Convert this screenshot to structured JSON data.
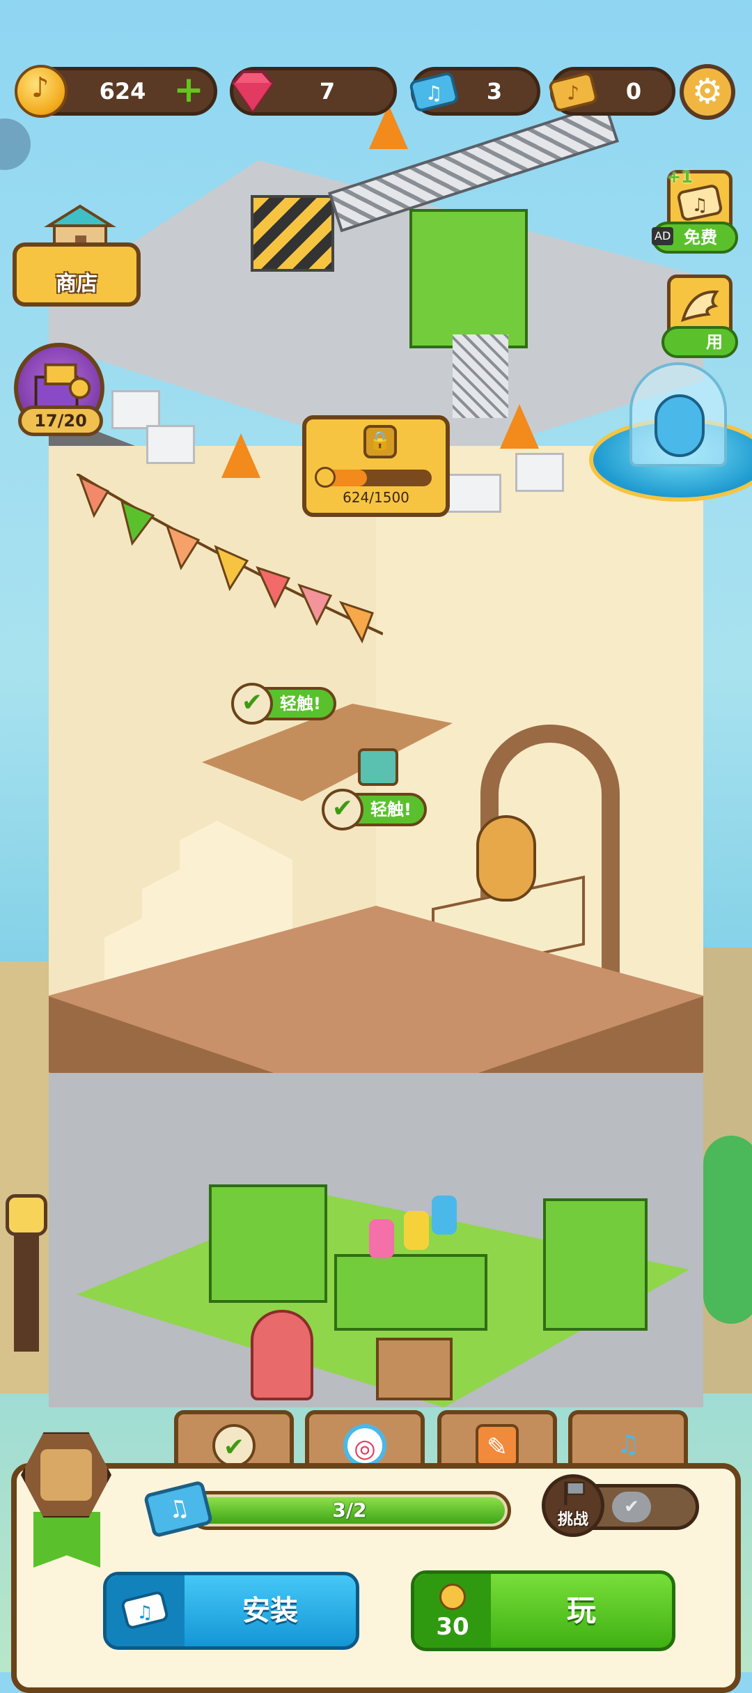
{
  "resources": {
    "coins": "624",
    "gems": "7",
    "tickets": "3",
    "golden_tickets": "0"
  },
  "side": {
    "shop_label": "商店",
    "chest_count": "17/20",
    "free_bonus": "+1",
    "free_label": "免费",
    "ad_tag": "AD",
    "use_label": "用"
  },
  "lock": {
    "progress_text": "624/1500",
    "progress_fraction": 0.416
  },
  "tap_prompts": [
    "轻触!",
    "轻触!"
  ],
  "bottom": {
    "ticket_progress": "3/2",
    "ticket_progress_fraction": 1.0,
    "challenge_label": "挑战",
    "install_label": "安装",
    "play_label": "玩",
    "play_cost": "30"
  },
  "colors": {
    "accent_green": "#5ac12c",
    "accent_blue": "#1496d6",
    "frame_brown": "#6b4319",
    "gold": "#f6c441"
  },
  "icons": {
    "coin": "music-note-coin-icon",
    "gem": "gem-icon",
    "ticket": "music-ticket-icon",
    "golden_ticket": "golden-ticket-icon",
    "settings": "gear-icon",
    "tabs": [
      "checkmark-shield-icon",
      "target-icon",
      "paint-book-icon",
      "music-list-icon"
    ]
  }
}
